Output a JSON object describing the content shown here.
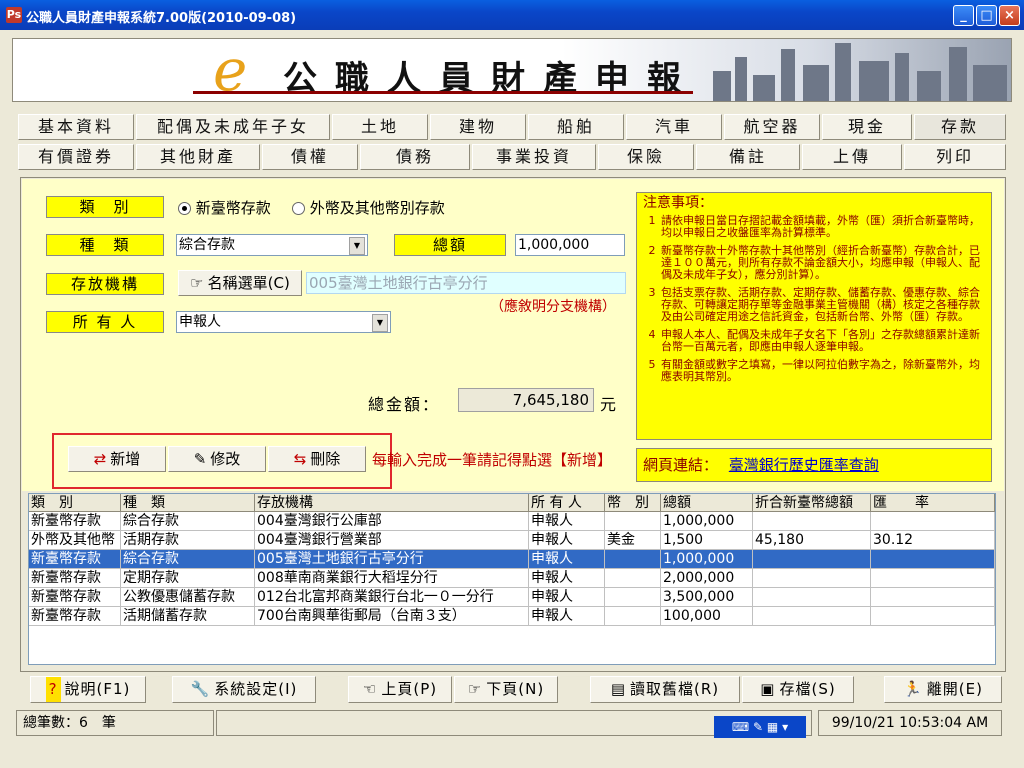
{
  "window": {
    "title": "公職人員財產申報系統7.00版(2010-09-08)"
  },
  "banner": {
    "e": "e",
    "title": "公職人員財產申報"
  },
  "tabs_row1": [
    "基本資料",
    "配偶及未成年子女",
    "土地",
    "建物",
    "船舶",
    "汽車",
    "航空器",
    "現金",
    "存款"
  ],
  "tabs_row2": [
    "有價證券",
    "其他財產",
    "債權",
    "債務",
    "事業投資",
    "保險",
    "備註",
    "上傳",
    "列印"
  ],
  "form": {
    "category_label": "類　別",
    "radio_twd": "新臺幣存款",
    "radio_foreign": "外幣及其他幣別存款",
    "type_label": "種　類",
    "type_value": "綜合存款",
    "amount_label": "總額",
    "amount_value": "1,000,000",
    "institution_label": "存放機構",
    "name_list_button": "名稱選單(C)",
    "institution_value": "005臺灣土地銀行古亭分行",
    "institution_hint": "（應敘明分支機構）",
    "owner_label": "所 有 人",
    "owner_value": "申報人",
    "total_label": "總金額：",
    "total_value": "7,645,180",
    "total_unit": "元"
  },
  "actions": {
    "add": "新增",
    "edit": "修改",
    "delete": "刪除",
    "reminder": "每輸入完成一筆請記得點選【新增】"
  },
  "notice": {
    "title": "注意事項：",
    "items": [
      {
        "num": "1",
        "text": "請依申報日當日存摺記載金額填載，外幣（匯）須折合新臺幣時，均以申報日之收盤匯率為計算標準。"
      },
      {
        "num": "2",
        "text": "新臺幣存款十外幣存款十其他幣別（經折合新臺幣）存款合計，已達１００萬元，則所有存款不論金額大小，均應申報（申報人、配偶及未成年子女），應分別計算）。"
      },
      {
        "num": "3",
        "text": "包括支票存款、活期存款、定期存款、儲蓄存款、優惠存款、綜合存款、可轉讓定期存單等金融事業主管機關（構）核定之各種存款及由公司確定用途之信託資金，包括新台幣、外幣（匯）存款。"
      },
      {
        "num": "4",
        "text": "申報人本人、配偶及未成年子女名下「各別」之存款總額累計達新台幣一百萬元者，即應由申報人逐筆申報。"
      },
      {
        "num": "5",
        "text": "有關金額或數字之填寫，一律以阿拉伯數字為之，除新臺幣外，均應表明其幣別。"
      }
    ],
    "link_label": "網頁連結：",
    "link_text": "臺灣銀行歷史匯率查詢"
  },
  "table": {
    "headers": [
      "類　別",
      "種　類",
      "存放機構",
      "所 有 人",
      "幣　別",
      "總額",
      "折合新臺幣總額",
      "匯　　率"
    ],
    "rows": [
      [
        "新臺幣存款",
        "綜合存款",
        "004臺灣銀行公庫部",
        "申報人",
        "",
        "1,000,000",
        "",
        ""
      ],
      [
        "外幣及其他幣",
        "活期存款",
        "004臺灣銀行營業部",
        "申報人",
        "美金",
        "1,500",
        "45,180",
        "30.12"
      ],
      [
        "新臺幣存款",
        "綜合存款",
        "005臺灣土地銀行古亭分行",
        "申報人",
        "",
        "1,000,000",
        "",
        ""
      ],
      [
        "新臺幣存款",
        "定期存款",
        "008華南商業銀行大稻埕分行",
        "申報人",
        "",
        "2,000,000",
        "",
        ""
      ],
      [
        "新臺幣存款",
        "公教優惠儲蓄存款",
        "012台北富邦商業銀行台北一０一分行",
        "申報人",
        "",
        "3,500,000",
        "",
        ""
      ],
      [
        "新臺幣存款",
        "活期儲蓄存款",
        "700台南興華街郵局（台南３支）",
        "申報人",
        "",
        "100,000",
        "",
        ""
      ]
    ],
    "selected_index": 2
  },
  "bottom": {
    "help": "說明(F1)",
    "settings": "系統設定(I)",
    "prev": "上頁(P)",
    "next": "下頁(N)",
    "load": "讀取舊檔(R)",
    "save": "存檔(S)",
    "exit": "離開(E)"
  },
  "status": {
    "count_label": "總筆數：6　筆",
    "datetime": "99/10/21  10:53:04 AM"
  }
}
